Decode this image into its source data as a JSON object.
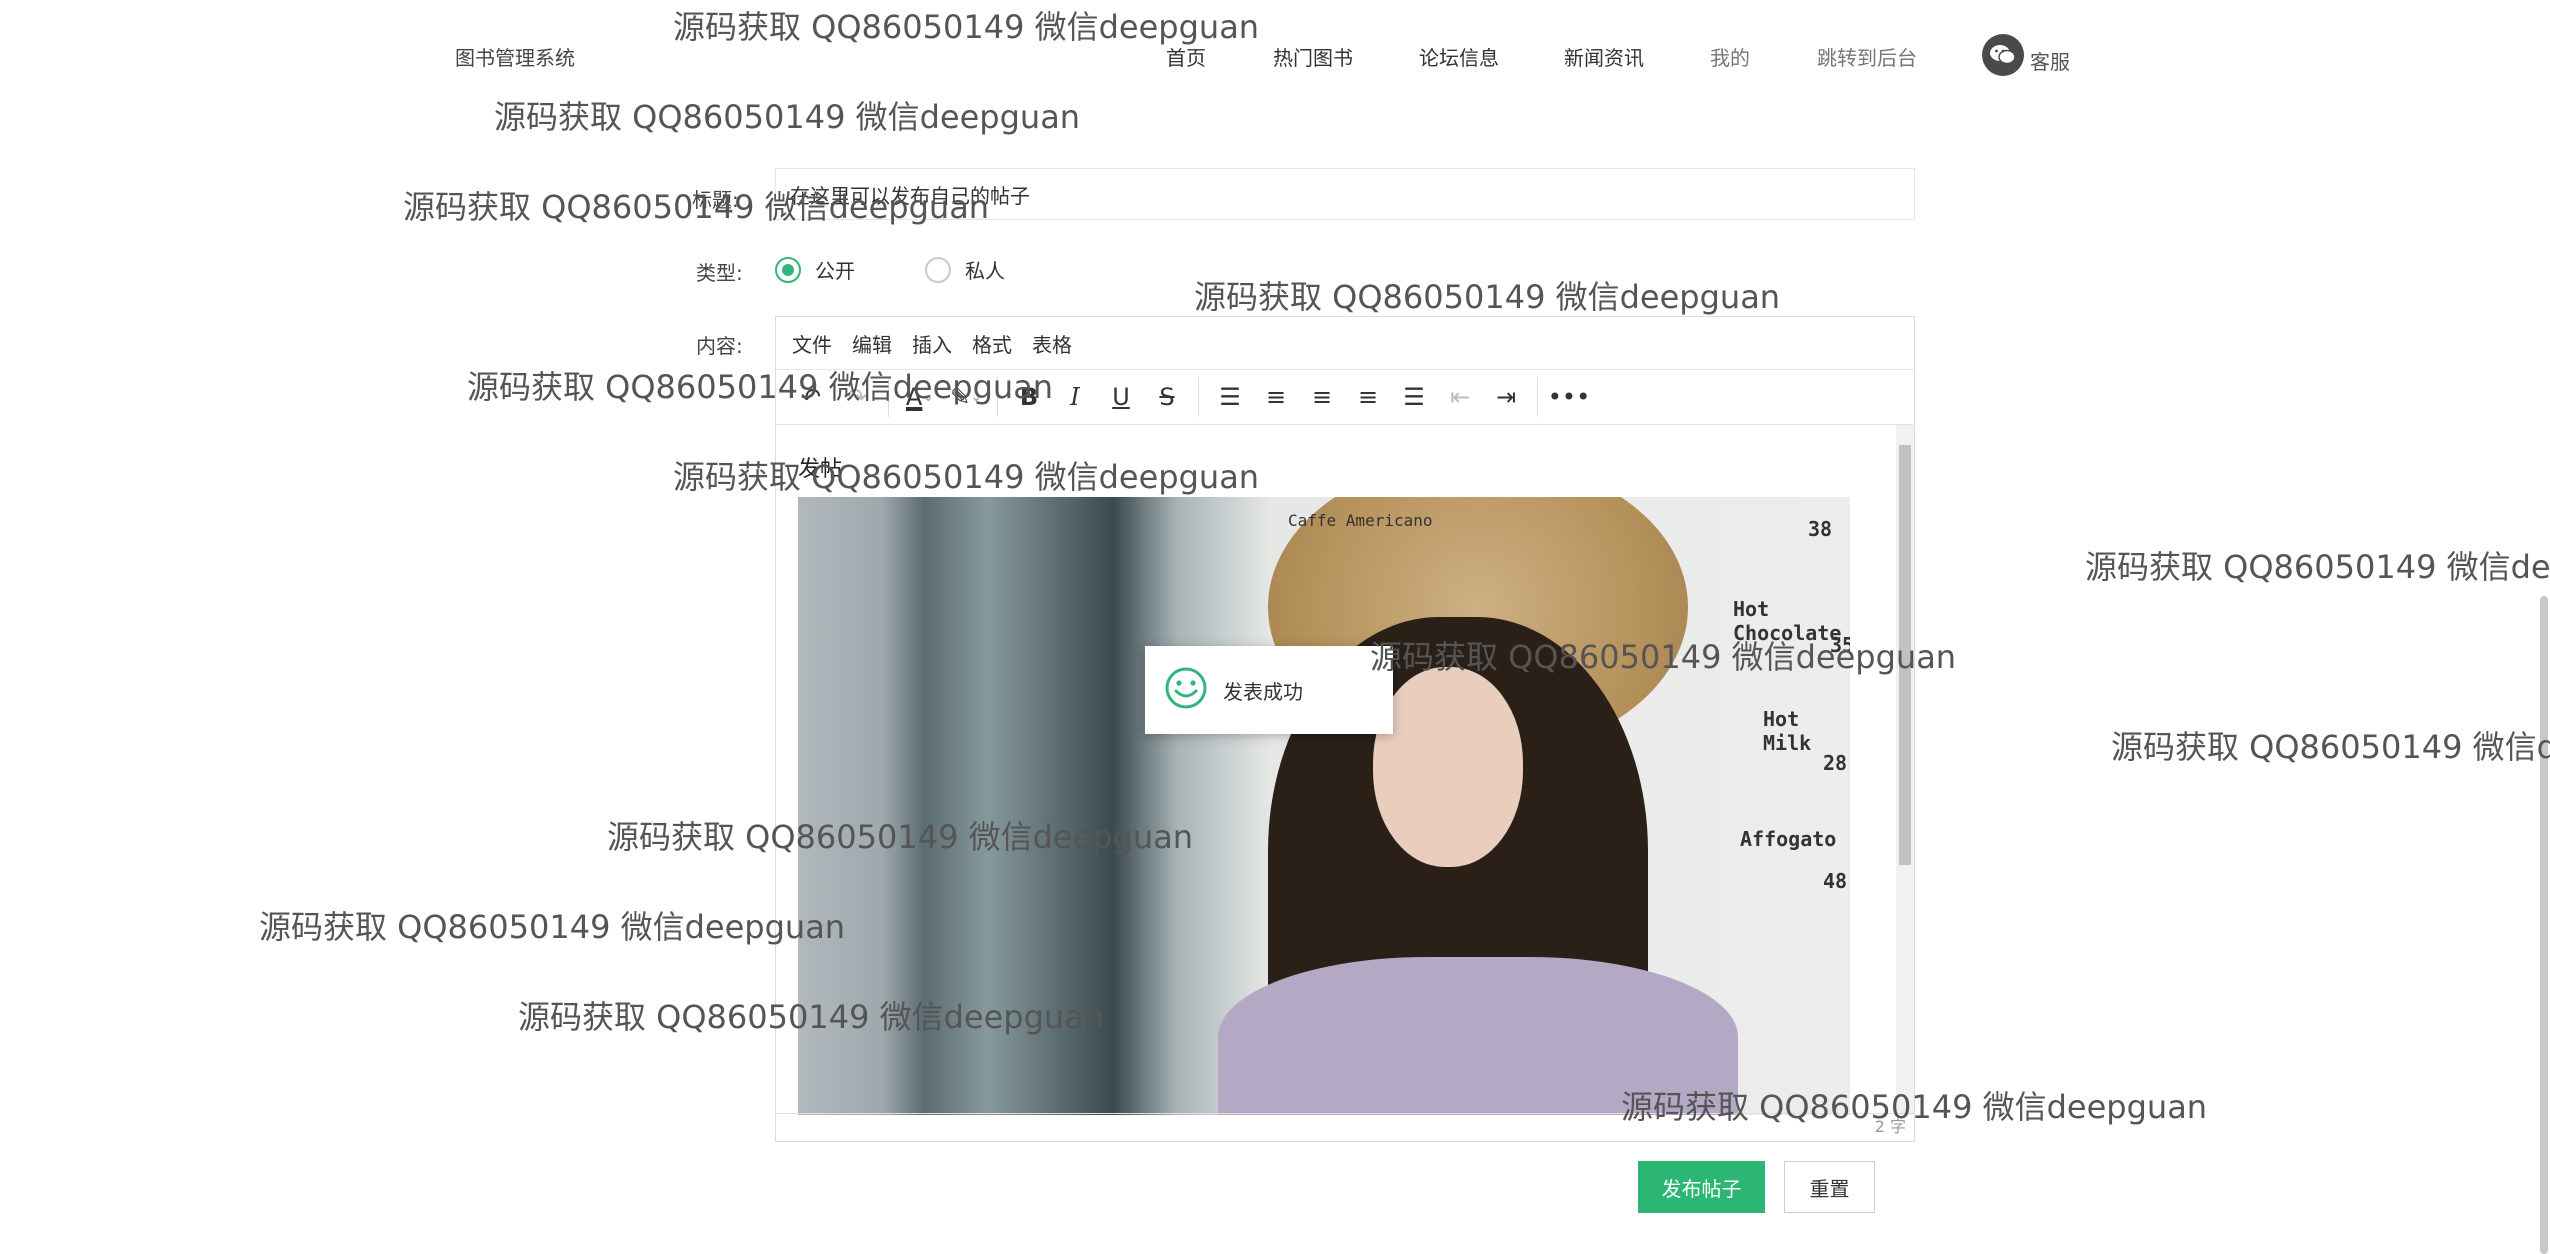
{
  "header": {
    "brand": "图书管理系统",
    "nav": [
      "首页",
      "热门图书",
      "论坛信息",
      "新闻资讯",
      "我的",
      "跳转到后台"
    ],
    "service_label": "客服",
    "service_icon": "wechat-icon"
  },
  "form": {
    "title_label": "标题:",
    "title_value": "在这里可以发布自己的帖子",
    "type_label": "类型:",
    "type_options": [
      "公开",
      "私人"
    ],
    "type_selected": "公开",
    "content_label": "内容:"
  },
  "editor": {
    "menu": [
      "文件",
      "编辑",
      "插入",
      "格式",
      "表格"
    ],
    "body_text": "发帖",
    "word_count": "2 字",
    "photo_menu": [
      "Caffe Americano",
      "38",
      "Hot Chocolate",
      "35",
      "Hot Milk",
      "28",
      "Affogato",
      "48"
    ]
  },
  "toast": {
    "message": "发表成功",
    "icon": "smile-icon"
  },
  "actions": {
    "submit": "发布帖子",
    "reset": "重置"
  },
  "watermark": "源码获取 QQ86050149 微信deepguan",
  "colors": {
    "primary": "#2bb673",
    "radio_active": "#33b47a"
  }
}
